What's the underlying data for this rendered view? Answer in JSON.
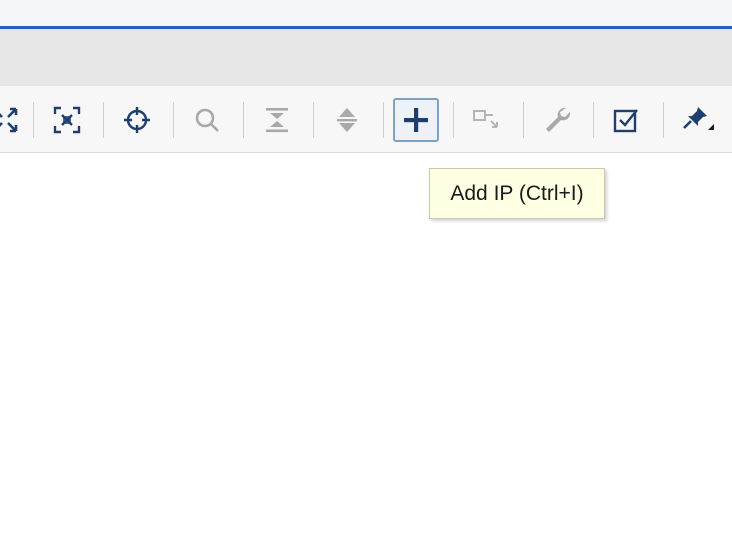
{
  "toolbar": {
    "buttons": [
      {
        "name": "fit-view",
        "icon": "expand-arrows-icon"
      },
      {
        "name": "fit-selection",
        "icon": "fit-selection-icon"
      },
      {
        "name": "auto-connect",
        "icon": "crosshair-icon"
      },
      {
        "name": "search",
        "icon": "search-icon"
      },
      {
        "name": "collapse-all",
        "icon": "collapse-icon"
      },
      {
        "name": "expand-all",
        "icon": "expand-icon"
      },
      {
        "name": "add-ip",
        "icon": "plus-icon",
        "active": true
      },
      {
        "name": "create-port",
        "icon": "port-icon",
        "disabled": true
      },
      {
        "name": "customize",
        "icon": "wrench-icon"
      },
      {
        "name": "validate-design",
        "icon": "checkbox-icon"
      },
      {
        "name": "pin",
        "icon": "pin-icon"
      }
    ]
  },
  "tooltip": {
    "text": "Add IP (Ctrl+I)"
  },
  "colors": {
    "accent_blue": "#1f5fbf",
    "icon_dark": "#1e3f6e",
    "icon_disabled": "#a9a9a9",
    "tooltip_bg": "#ffffe4"
  }
}
